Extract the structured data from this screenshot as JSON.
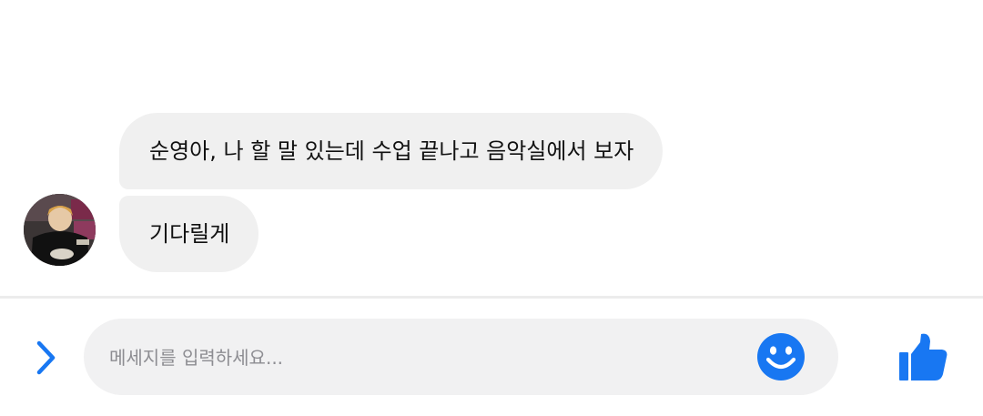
{
  "messages": [
    {
      "text": "순영아, 나 할 말 있는데 수업 끝나고 음악실에서 보자"
    },
    {
      "text": "기다릴게"
    }
  ],
  "composer": {
    "placeholder": "메세지를 입력하세요..."
  },
  "colors": {
    "accent": "#1877f2",
    "bubble": "#f0f0f0",
    "input_background": "#f1f1f2",
    "divider": "#ececec"
  },
  "icons": {
    "expand": "chevron-right-icon",
    "emoji": "smiley-icon",
    "like": "thumbs-up-icon"
  }
}
